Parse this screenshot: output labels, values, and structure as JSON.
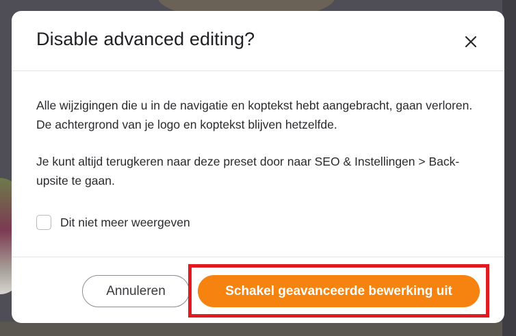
{
  "dialog": {
    "title": "Disable advanced editing?",
    "close_icon": "close-icon",
    "paragraphs": [
      "Alle wijzigingen die u in de navigatie en koptekst hebt aangebracht, gaan verloren. De achtergrond van je logo en koptekst blijven hetzelfde.",
      "Je kunt altijd terugkeren naar deze preset door naar SEO & Instellingen > Back-upsite te gaan."
    ],
    "checkbox": {
      "label": "Dit niet meer weergeven",
      "checked": false
    },
    "buttons": {
      "cancel_label": "Annuleren",
      "confirm_label": "Schakel geavanceerde bewerking uit"
    }
  },
  "colors": {
    "accent": "#f6830f",
    "highlight": "#e11a22"
  }
}
